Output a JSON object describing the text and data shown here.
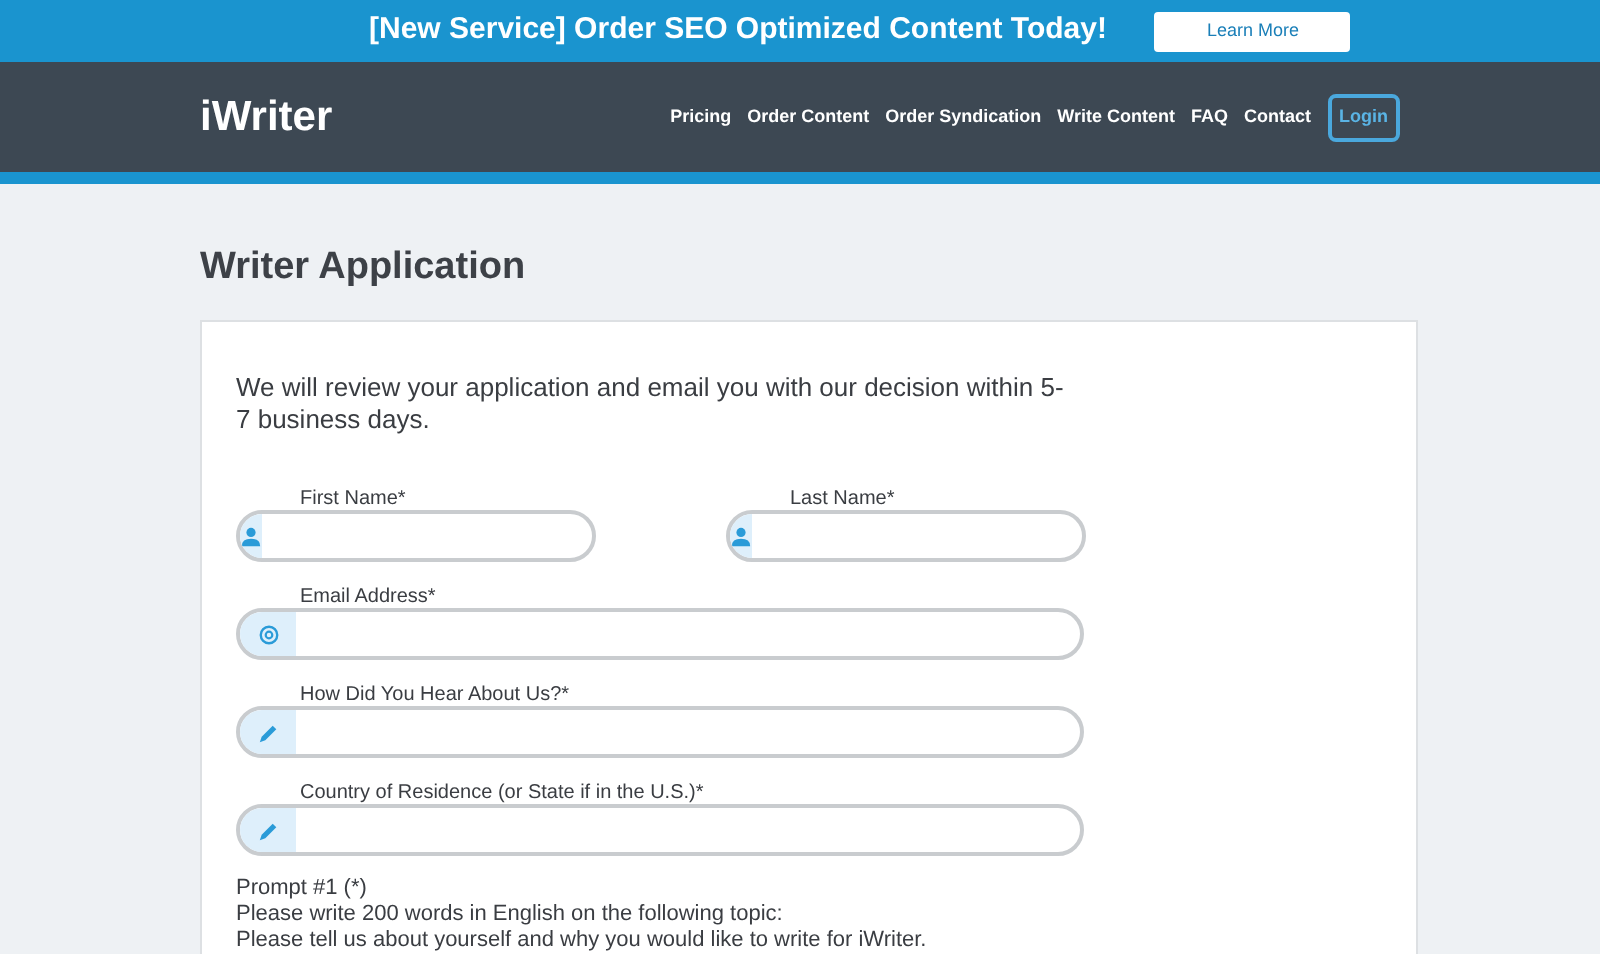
{
  "banner": {
    "text": "[New Service] Order SEO Optimized Content Today!",
    "button": "Learn More"
  },
  "nav": {
    "logo": "iWriter",
    "links": [
      "Pricing",
      "Order Content",
      "Order Syndication",
      "Write Content",
      "FAQ",
      "Contact"
    ],
    "login": "Login"
  },
  "page_title": "Writer Application",
  "intro": "We will review your application and email you with our decision within 5-7 business days.",
  "field_rows": [
    [
      {
        "label": "First Name*",
        "kind": "person"
      },
      {
        "label": "Last Name*",
        "kind": "person"
      }
    ],
    [
      {
        "label": "Email Address*",
        "kind": "at"
      }
    ],
    [
      {
        "label": "How Did You Hear About Us?*",
        "kind": "pen"
      }
    ],
    [
      {
        "label": "Country of Residence (or State if in the U.S.)*",
        "kind": "pen"
      }
    ]
  ],
  "prompt_lines": [
    "Prompt #1 (*)",
    "Please write 200 words in English on the following topic:",
    "Please tell us about yourself and why you would like to write for iWriter."
  ]
}
